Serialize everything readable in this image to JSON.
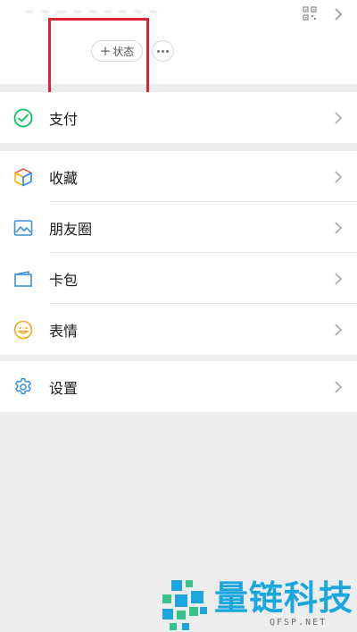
{
  "header": {
    "blurred_name": "~ ~ — ~ ~ ~ ~ ~ ~",
    "status_button": {
      "plus": "+",
      "label": "状态"
    }
  },
  "menu": {
    "pay": "支付",
    "favorites": "收藏",
    "moments": "朋友圈",
    "cards": "卡包",
    "stickers": "表情",
    "settings": "设置"
  },
  "colors": {
    "pay_green": "#07c160",
    "favorites_red": "#f05a4a",
    "favorites_yellow": "#f7b500",
    "favorites_blue": "#2f8ee8",
    "moments_blue": "#3a8fd8",
    "cards_blue": "#3a8fd8",
    "stickers_yellow": "#f0a81e",
    "settings_blue": "#3a8fd8",
    "highlight_red": "#d9262f"
  },
  "watermark": {
    "brand": "量链科技",
    "url": "QFSP.NET"
  }
}
